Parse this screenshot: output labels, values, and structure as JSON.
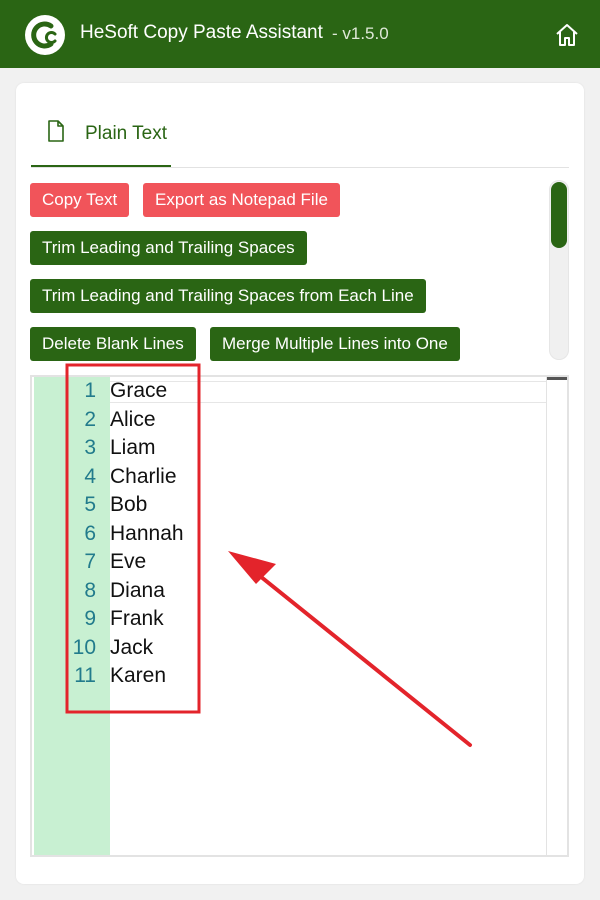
{
  "header": {
    "title": "HeSoft Copy Paste Assistant",
    "version": "- v1.5.0",
    "icons": {
      "logo": "app-logo",
      "home": "home-icon"
    }
  },
  "tabs": [
    {
      "label": "Plain Text",
      "icon": "document-icon",
      "active": true
    }
  ],
  "buttons": {
    "copy_text": "Copy Text",
    "export_notepad": "Export as Notepad File",
    "trim_spaces": "Trim Leading and Trailing Spaces",
    "trim_each_line": "Trim Leading and Trailing Spaces from Each Line",
    "delete_blank": "Delete Blank Lines",
    "merge_lines": "Merge Multiple Lines into One"
  },
  "editor": {
    "line_numbers": [
      "1",
      "2",
      "3",
      "4",
      "5",
      "6",
      "7",
      "8",
      "9",
      "10",
      "11"
    ],
    "lines": [
      "Grace",
      "Alice",
      "Liam",
      "Charlie",
      "Bob",
      "Hannah",
      "Eve",
      "Diana",
      "Frank",
      "Jack",
      "Karen"
    ]
  },
  "colors": {
    "brand_green": "#2a6514",
    "accent_red": "#f1545a",
    "gutter_green": "#c8f0d2",
    "line_number": "#227b8c",
    "annotation_red": "#e3242b"
  }
}
